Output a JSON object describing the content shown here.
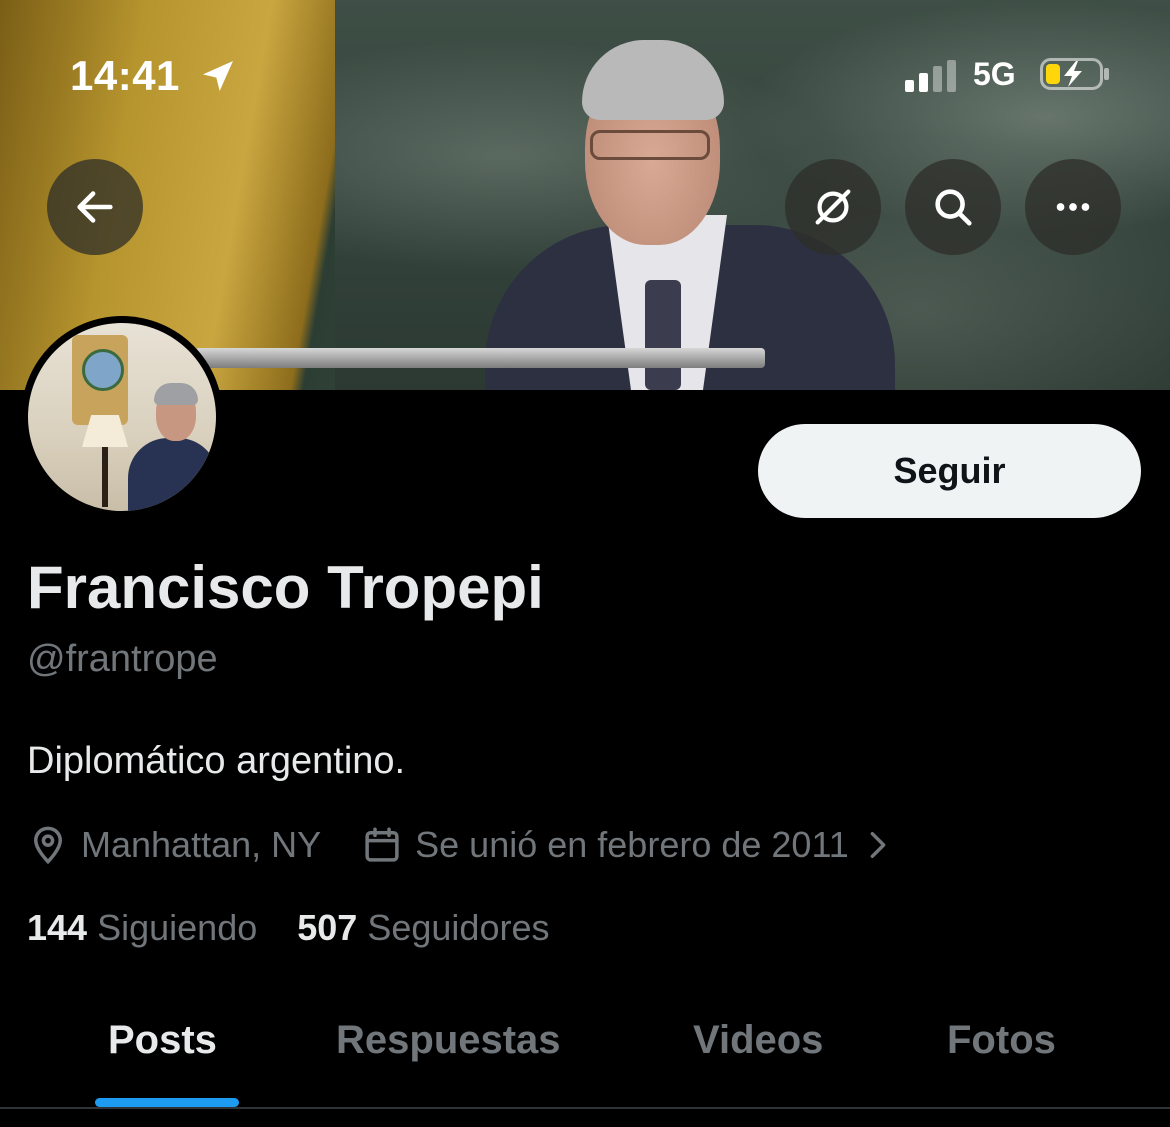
{
  "status_bar": {
    "time": "14:41",
    "network": "5G"
  },
  "header": {
    "back_icon": "arrow-left-icon",
    "action_icons": [
      "grok-icon",
      "search-icon",
      "more-icon"
    ]
  },
  "profile": {
    "follow_label": "Seguir",
    "name": "Francisco Tropepi",
    "handle": "@frantrope",
    "bio": "Diplomático argentino.",
    "location": "Manhattan, NY",
    "joined": "Se unió en febrero de 2011",
    "following_count": "144",
    "following_label": "Siguiendo",
    "followers_count": "507",
    "followers_label": "Seguidores"
  },
  "tabs": [
    {
      "label": "Posts",
      "active": true
    },
    {
      "label": "Respuestas",
      "active": false
    },
    {
      "label": "Videos",
      "active": false
    },
    {
      "label": "Fotos",
      "active": false
    }
  ],
  "colors": {
    "accent": "#1d9bf0",
    "muted_text": "#71767b",
    "primary_text": "#e7e9ea",
    "background": "#000000"
  }
}
